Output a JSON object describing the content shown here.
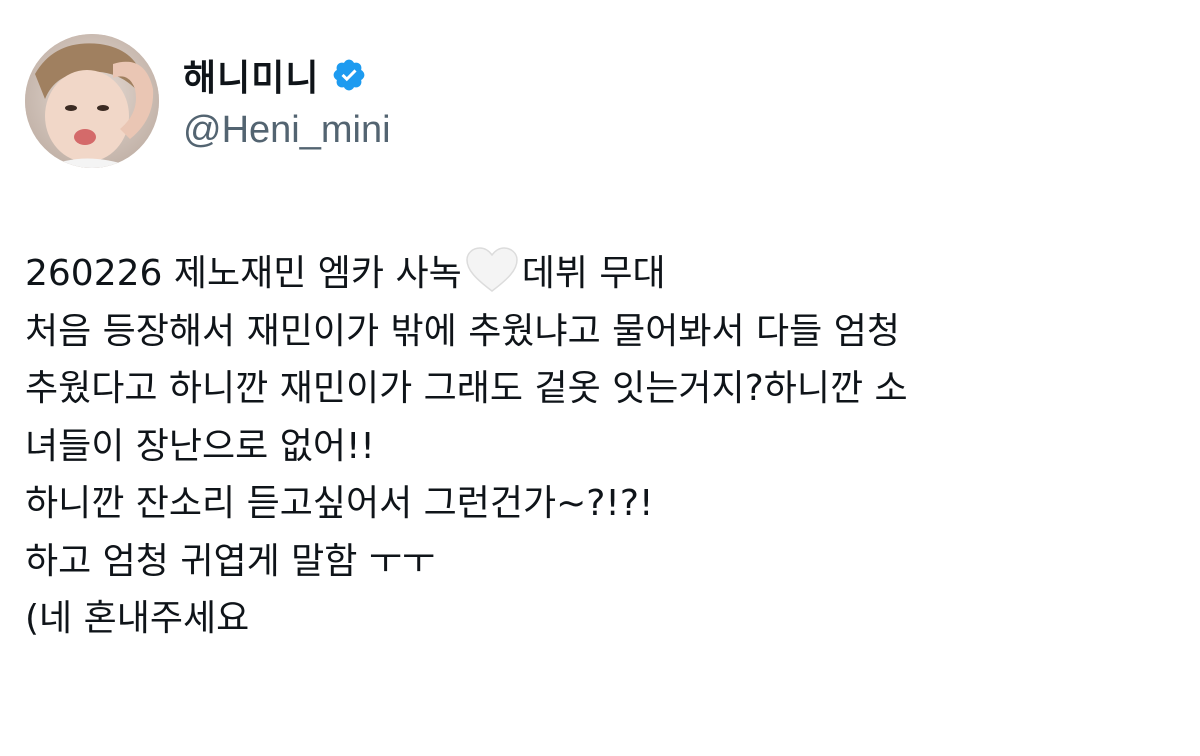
{
  "author": {
    "display_name": "해니미니",
    "handle": "@Heni_mini",
    "verified": true,
    "verified_icon": "verified-badge-icon",
    "verified_color": "#1d9bf0"
  },
  "tweet": {
    "line1_before_heart": "260226 제노재민 엠카 사녹",
    "heart_icon": "white-heart-emoji",
    "line1_after_heart": "데뷔 무대",
    "line2": "처음 등장해서 재민이가 밖에 추웠냐고 물어봐서 다들 엄청",
    "line3": "추웠다고 하니깐 재민이가 그래도 겉옷 잇는거지?하니깐 소",
    "line4": "녀들이 장난으로 없어!!",
    "line5": "하니깐 잔소리 듣고싶어서 그런건가~?!?!",
    "line6": "하고 엄청 귀엽게 말함 ㅜㅜ",
    "line7": "(네 혼내주세요"
  },
  "colors": {
    "text": "#0f1419",
    "secondary_text": "#536471",
    "background": "#ffffff"
  }
}
